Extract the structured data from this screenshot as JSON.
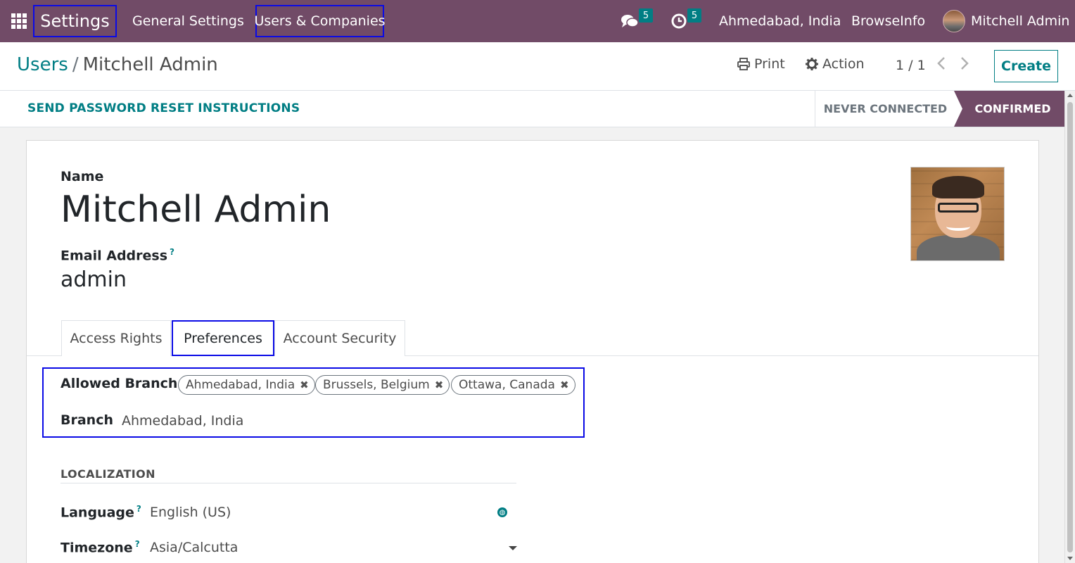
{
  "navbar": {
    "app_name": "Settings",
    "menu": [
      "General Settings",
      "Users & Companies"
    ],
    "messages_count": "5",
    "activities_count": "5",
    "current_branch": "Ahmedabad, India",
    "company": "BrowseInfo",
    "user_name": "Mitchell Admin"
  },
  "breadcrumb": {
    "parent": "Users",
    "separator": "/",
    "current": "Mitchell Admin"
  },
  "control": {
    "print_label": "Print",
    "action_label": "Action",
    "pager": "1 / 1",
    "create_label": "Create"
  },
  "statusbar": {
    "reset_label": "SEND PASSWORD RESET INSTRUCTIONS",
    "stages": [
      "NEVER CONNECTED",
      "CONFIRMED"
    ],
    "active_stage": "CONFIRMED"
  },
  "form": {
    "name_label": "Name",
    "name_value": "Mitchell Admin",
    "email_label": "Email Address",
    "email_value": "admin",
    "tabs": [
      "Access Rights",
      "Preferences",
      "Account Security"
    ],
    "active_tab": "Preferences",
    "allowed_branch_label": "Allowed Branch",
    "allowed_branches": [
      "Ahmedabad, India",
      "Brussels, Belgium",
      "Ottawa, Canada"
    ],
    "branch_label": "Branch",
    "branch_value": "Ahmedabad, India",
    "localization_title": "LOCALIZATION",
    "language_label": "Language",
    "language_value": "English (US)",
    "timezone_label": "Timezone",
    "timezone_value": "Asia/Calcutta"
  },
  "icons": {
    "apps": "apps-grid-icon",
    "messages": "chat-icon",
    "activities": "clock-icon",
    "print": "printer-icon",
    "action": "gear-icon",
    "pager_prev": "chevron-left-icon",
    "pager_next": "chevron-right-icon",
    "tag_remove": "close-icon",
    "language": "globe-icon",
    "timezone": "caret-down-icon"
  },
  "colors": {
    "brand": "#714b67",
    "accent": "#017e84",
    "highlight_border": "#0a0ae6"
  }
}
